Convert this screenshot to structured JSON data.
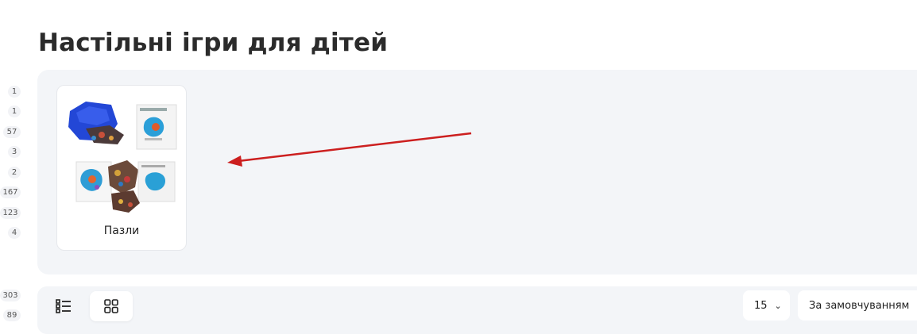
{
  "page": {
    "title": "Настільні ігри для дітей"
  },
  "filter_counts": [
    "1",
    "1",
    "57",
    "3",
    "2",
    "167",
    "123",
    "4",
    "303",
    "89"
  ],
  "categories": [
    {
      "label": "Пазли",
      "icon": "puzzle-product-image"
    }
  ],
  "toolbar": {
    "view_list_icon": "list-view-icon",
    "view_grid_icon": "grid-view-icon",
    "per_page": "15",
    "sort": "За замовчуванням",
    "chevron": "⌄"
  },
  "annotation": {
    "arrow_color": "#cc1f1f"
  }
}
